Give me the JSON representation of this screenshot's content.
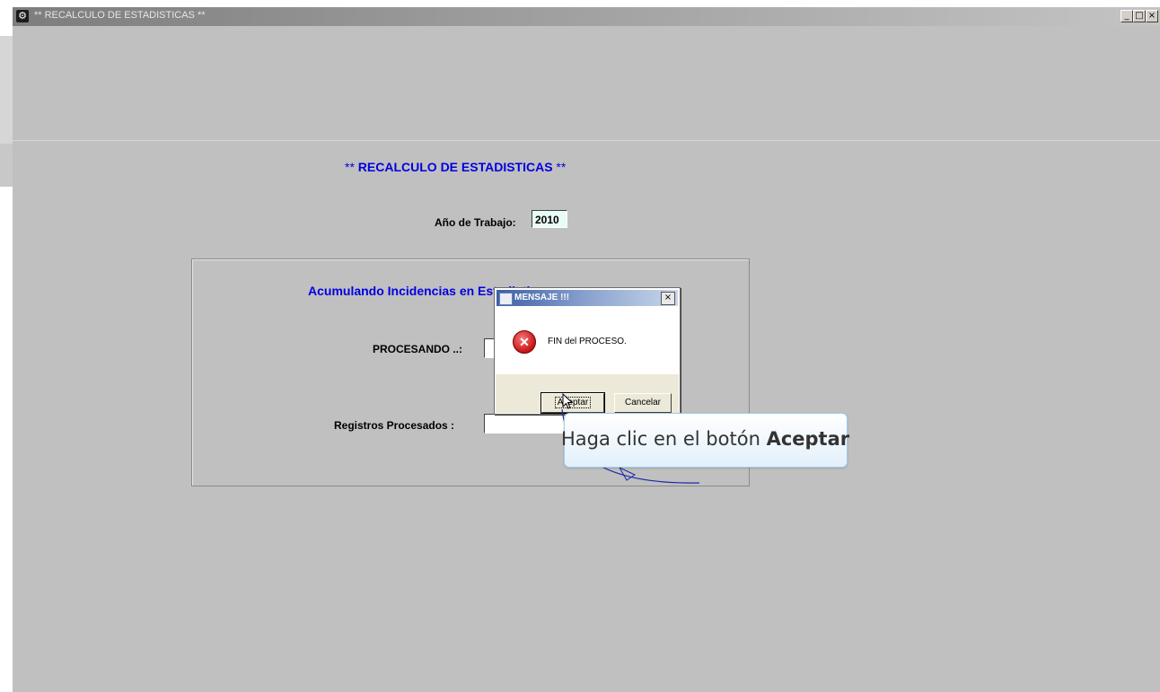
{
  "window": {
    "title": "** RECALCULO DE ESTADISTICAS **",
    "controls": {
      "minimize": "_",
      "maximize": "□",
      "close": "×"
    }
  },
  "form": {
    "heading_stars_left": "** ",
    "heading": "RECALCULO DE ESTADISTICAS",
    "heading_stars_right": " **",
    "year_label": "Año de Trabajo:",
    "year_value": "2010",
    "group_title": "Acumulando Incidencias en Estadisticas",
    "processing_label": "PROCESANDO ..:",
    "processing_value": "",
    "records_label": "Registros Procesados :",
    "records_value": ""
  },
  "dialog": {
    "title": "MENSAJE !!!",
    "close": "×",
    "message": "FIN del PROCESO.",
    "icon": "error-icon",
    "ok_label": "Aceptar",
    "cancel_label": "Cancelar"
  },
  "callout": {
    "text_prefix": "Haga clic en el botón ",
    "text_bold": "Aceptar"
  },
  "colors": {
    "window_bg": "#c0c0c0",
    "heading_blue": "#0000e0",
    "year_field_bg": "#e9fbf6"
  }
}
